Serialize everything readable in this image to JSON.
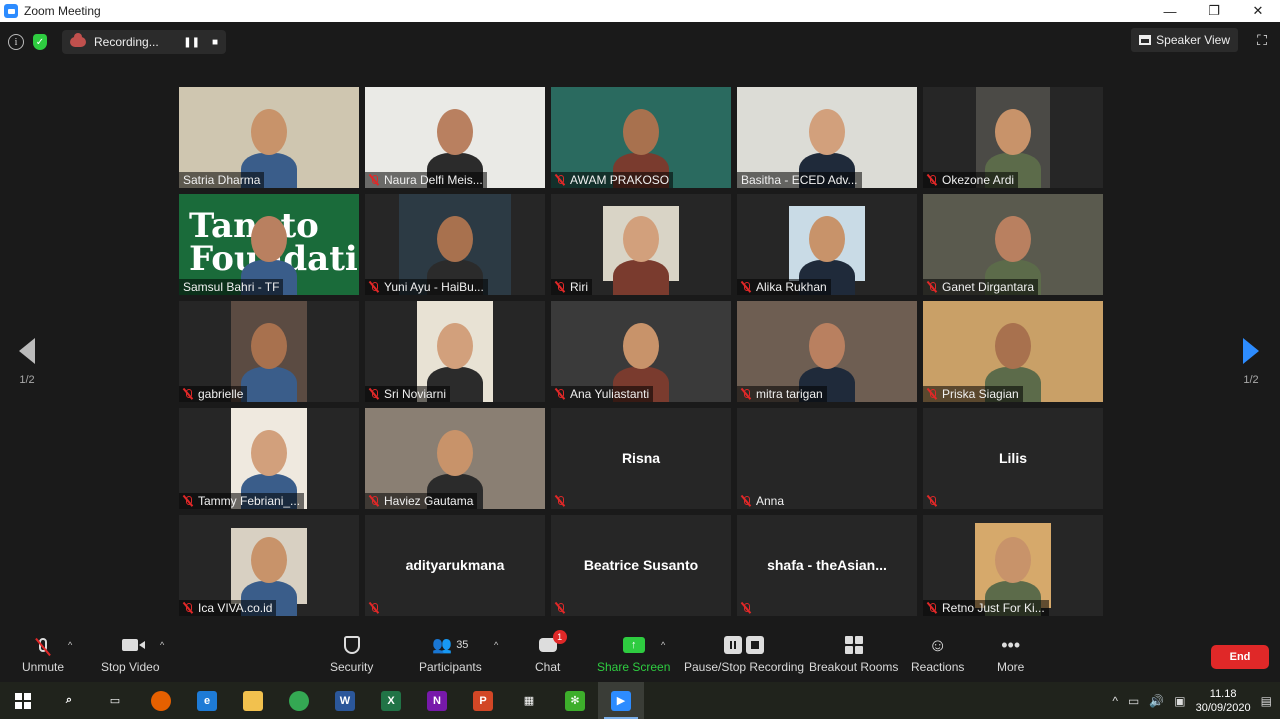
{
  "window": {
    "title": "Zoom Meeting",
    "controls": [
      "—",
      "❐",
      "✕"
    ]
  },
  "topbar": {
    "recording_label": "Recording...",
    "pause_symbol": "❚❚",
    "stop_symbol": "■",
    "speaker_view_label": "Speaker View"
  },
  "pagination": {
    "left": "1/2",
    "right": "1/2"
  },
  "tiles": [
    {
      "name": "Satria Dharma",
      "muted": false,
      "bg": "#cfc6b0"
    },
    {
      "name": "Naura Delfi Meis...",
      "muted": true,
      "bg": "#eaeae6"
    },
    {
      "name": "AWAM PRAKOSO",
      "muted": true,
      "bg": "#2a6a5f"
    },
    {
      "name": "Basitha - ECED Adv...",
      "muted": false,
      "bg": "#dcdcd6",
      "active": true
    },
    {
      "name": "Okezone Ardi",
      "muted": true,
      "bg": "#262626"
    },
    {
      "name": "Samsul Bahri - TF",
      "muted": false,
      "bg": "#1a6b3a",
      "overlay_text": [
        "Tanoto",
        "Foundation"
      ]
    },
    {
      "name": "Yuni Ayu - HaiBu...",
      "muted": true,
      "bg": "#262626"
    },
    {
      "name": "Riri",
      "muted": true,
      "bg": "#262626"
    },
    {
      "name": "Alika Rukhan",
      "muted": true,
      "bg": "#262626"
    },
    {
      "name": "Ganet Dirgantara",
      "muted": true,
      "bg": "#5a5a4e"
    },
    {
      "name": "gabrielle",
      "muted": true,
      "bg": "#262626"
    },
    {
      "name": "Sri Noviarni",
      "muted": true,
      "bg": "#262626"
    },
    {
      "name": "Ana Yuliastanti",
      "muted": true,
      "bg": "#3a3a3a"
    },
    {
      "name": "mitra tarigan",
      "muted": true,
      "bg": "#6e5e52"
    },
    {
      "name": "Priska Siagian",
      "muted": true,
      "bg": "#c9a067"
    },
    {
      "name": "Tammy Febriani_...",
      "muted": true,
      "bg": "#262626"
    },
    {
      "name": "Haviez Gautama",
      "muted": true,
      "bg": "#8a7f73"
    },
    {
      "name": "",
      "muted": true,
      "center": "Risna"
    },
    {
      "name": "Anna",
      "muted": true,
      "center": ""
    },
    {
      "name": "",
      "muted": true,
      "center": "Lilis"
    },
    {
      "name": "Ica VIVA.co.id",
      "muted": true,
      "bg": "#262626"
    },
    {
      "name": "",
      "muted": true,
      "center": "adityarukmana"
    },
    {
      "name": "",
      "muted": true,
      "center": "Beatrice Susanto"
    },
    {
      "name": "",
      "muted": true,
      "center": "shafa - theAsian..."
    },
    {
      "name": "Retno Just For Ki...",
      "muted": true,
      "bg": "#262626"
    }
  ],
  "toolbar": {
    "unmute": "Unmute",
    "stop_video": "Stop Video",
    "security": "Security",
    "participants": "Participants",
    "participants_count": "35",
    "chat": "Chat",
    "chat_badge": "1",
    "share_screen": "Share Screen",
    "pause_stop_recording": "Pause/Stop Recording",
    "breakout_rooms": "Breakout Rooms",
    "reactions": "Reactions",
    "more": "More",
    "end": "End"
  },
  "taskbar": {
    "time": "11.18",
    "date": "30/09/2020",
    "apps": [
      {
        "name": "search-icon",
        "label": "⌕",
        "color": "transparent"
      },
      {
        "name": "task-view-icon",
        "label": "▭",
        "color": "transparent"
      },
      {
        "name": "firefox-icon",
        "label": "",
        "color": "#e66000"
      },
      {
        "name": "edge-icon",
        "label": "e",
        "color": "#1e7bd6"
      },
      {
        "name": "file-explorer-icon",
        "label": "",
        "color": "#f2c14e"
      },
      {
        "name": "chrome-icon",
        "label": "",
        "color": "#34a853"
      },
      {
        "name": "word-icon",
        "label": "W",
        "color": "#2b579a"
      },
      {
        "name": "excel-icon",
        "label": "X",
        "color": "#217346"
      },
      {
        "name": "onenote-icon",
        "label": "N",
        "color": "#7719aa"
      },
      {
        "name": "powerpoint-icon",
        "label": "P",
        "color": "#d24726"
      },
      {
        "name": "store-icon",
        "label": "▦",
        "color": "transparent"
      },
      {
        "name": "green-app-icon",
        "label": "✻",
        "color": "#3dae2b"
      },
      {
        "name": "zoom-icon",
        "label": "▶",
        "color": "#2d8cff"
      }
    ]
  }
}
